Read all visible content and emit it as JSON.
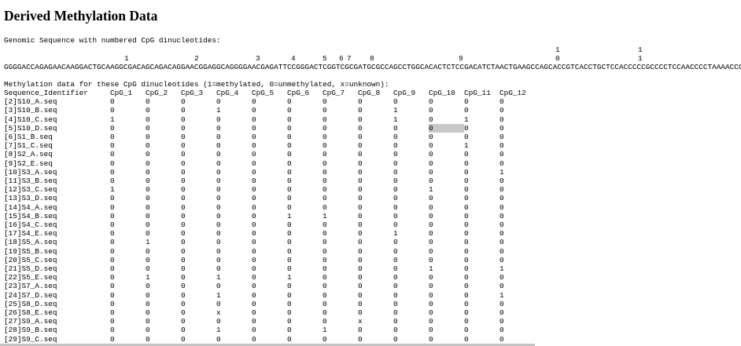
{
  "page": {
    "title": "Derived Methylation Data",
    "genomic_label": "Genomic Sequence with numbered CpG dinucleotides:",
    "sequence": "GGGGACCAGAGAACAAGGACTGCAAGGCGACAGCAGACAGGAACGGAGGCAGGGGAACGAGATTCCGGGACTCGGTCGCGATGCGCCAGCCTGGCACACTCTCCGACATCTAACTGAAGCCAGCACCGTCACCTGCTCCACCCCCGCCCCTCCAACCCCTAAAACCCC",
    "cpg_markers_top": [
      {
        "label": "1",
        "col": 706
      },
      {
        "label": "1",
        "col": 811
      }
    ],
    "cpg_markers": [
      {
        "label": "1",
        "col": 158
      },
      {
        "label": "2",
        "col": 247
      },
      {
        "label": "3",
        "col": 325
      },
      {
        "label": "4",
        "col": 370
      },
      {
        "label": "5",
        "col": 410
      },
      {
        "label": "6",
        "col": 431
      },
      {
        "label": "7",
        "col": 441
      },
      {
        "label": "8",
        "col": 470
      },
      {
        "label": "9",
        "col": 583
      },
      {
        "label": "0",
        "col": 706
      },
      {
        "label": "1",
        "col": 811
      }
    ],
    "methylation_label": "Methylation data for these CpG dinucleotides (1=methylated, 0=unmethylated, x=unknown):"
  },
  "table": {
    "headers": [
      "Sequence_Identifier",
      "CpG_1",
      "CpG_2",
      "CpG_3",
      "CpG_4",
      "CpG_5",
      "CpG_6",
      "CpG_7",
      "CpG_8",
      "CpG_9",
      "CpG_10",
      "CpG_11",
      "CpG_12"
    ],
    "rows": [
      [
        "[2]S10_A.seq",
        "0",
        "0",
        "0",
        "0",
        "0",
        "0",
        "0",
        "0",
        "0",
        "0",
        "0",
        "0"
      ],
      [
        "[3]S10_B.seq",
        "0",
        "0",
        "0",
        "1",
        "0",
        "0",
        "0",
        "0",
        "1",
        "0",
        "0",
        "0"
      ],
      [
        "[4]S10_C.seq",
        "1",
        "0",
        "0",
        "0",
        "0",
        "0",
        "0",
        "0",
        "1",
        "0",
        "1",
        "0"
      ],
      [
        "[5]S10_D.seq",
        "0",
        "0",
        "0",
        "0",
        "0",
        "0",
        "0",
        "0",
        "0",
        "0",
        "0",
        "0"
      ],
      [
        "[6]S1_B.seq",
        "0",
        "0",
        "0",
        "0",
        "0",
        "0",
        "0",
        "0",
        "0",
        "0",
        "0",
        "0"
      ],
      [
        "[7]S1_C.seq",
        "0",
        "0",
        "0",
        "0",
        "0",
        "0",
        "0",
        "0",
        "0",
        "0",
        "1",
        "0"
      ],
      [
        "[8]S2_A.seq",
        "0",
        "0",
        "0",
        "0",
        "0",
        "0",
        "0",
        "0",
        "0",
        "0",
        "0",
        "0"
      ],
      [
        "[9]S2_E.seq",
        "0",
        "0",
        "0",
        "0",
        "0",
        "0",
        "0",
        "0",
        "0",
        "0",
        "0",
        "0"
      ],
      [
        "[10]S3_A.seq",
        "0",
        "0",
        "0",
        "0",
        "0",
        "0",
        "0",
        "0",
        "0",
        "0",
        "0",
        "1"
      ],
      [
        "[11]S3_B.seq",
        "0",
        "0",
        "0",
        "0",
        "0",
        "0",
        "0",
        "0",
        "0",
        "0",
        "0",
        "0"
      ],
      [
        "[12]S3_C.seq",
        "1",
        "0",
        "0",
        "0",
        "0",
        "0",
        "0",
        "0",
        "0",
        "1",
        "0",
        "0"
      ],
      [
        "[13]S3_D.seq",
        "0",
        "0",
        "0",
        "0",
        "0",
        "0",
        "0",
        "0",
        "0",
        "0",
        "0",
        "0"
      ],
      [
        "[14]S4_A.seq",
        "0",
        "0",
        "0",
        "0",
        "0",
        "0",
        "0",
        "0",
        "0",
        "0",
        "0",
        "0"
      ],
      [
        "[15]S4_B.seq",
        "0",
        "0",
        "0",
        "0",
        "0",
        "1",
        "1",
        "0",
        "0",
        "0",
        "0",
        "0"
      ],
      [
        "[16]S4_C.seq",
        "0",
        "0",
        "0",
        "0",
        "0",
        "0",
        "0",
        "0",
        "0",
        "0",
        "0",
        "0"
      ],
      [
        "[17]S4_E.seq",
        "0",
        "0",
        "0",
        "0",
        "0",
        "0",
        "0",
        "0",
        "1",
        "0",
        "0",
        "0"
      ],
      [
        "[18]S5_A.seq",
        "0",
        "1",
        "0",
        "0",
        "0",
        "0",
        "0",
        "0",
        "0",
        "0",
        "0",
        "0"
      ],
      [
        "[19]S5_B.seq",
        "0",
        "0",
        "0",
        "0",
        "0",
        "0",
        "0",
        "0",
        "0",
        "0",
        "0",
        "0"
      ],
      [
        "[20]S5_C.seq",
        "0",
        "0",
        "0",
        "0",
        "0",
        "0",
        "0",
        "0",
        "0",
        "0",
        "0",
        "0"
      ],
      [
        "[21]S5_D.seq",
        "0",
        "0",
        "0",
        "0",
        "0",
        "0",
        "0",
        "0",
        "0",
        "1",
        "0",
        "1"
      ],
      [
        "[22]S5_E.seq",
        "0",
        "1",
        "0",
        "1",
        "0",
        "1",
        "0",
        "0",
        "0",
        "0",
        "0",
        "0"
      ],
      [
        "[23]S7_A.seq",
        "0",
        "0",
        "0",
        "0",
        "0",
        "0",
        "0",
        "0",
        "0",
        "0",
        "0",
        "0"
      ],
      [
        "[24]S7_D.seq",
        "0",
        "0",
        "0",
        "1",
        "0",
        "0",
        "0",
        "0",
        "0",
        "0",
        "0",
        "1"
      ],
      [
        "[25]S8_D.seq",
        "0",
        "0",
        "0",
        "0",
        "0",
        "0",
        "0",
        "0",
        "0",
        "0",
        "0",
        "0"
      ],
      [
        "[26]S8_E.seq",
        "0",
        "0",
        "0",
        "x",
        "0",
        "0",
        "0",
        "0",
        "0",
        "0",
        "0",
        "0"
      ],
      [
        "[27]S9_A.seq",
        "0",
        "0",
        "0",
        "0",
        "0",
        "0",
        "0",
        "x",
        "0",
        "0",
        "0",
        "0"
      ],
      [
        "[28]S9_B.seq",
        "0",
        "0",
        "0",
        "1",
        "0",
        "0",
        "1",
        "0",
        "0",
        "0",
        "0",
        "0"
      ],
      [
        "[29]S9_C.seq",
        "0",
        "0",
        "0",
        "0",
        "0",
        "0",
        "0",
        "0",
        "0",
        "0",
        "0",
        "0"
      ]
    ],
    "highlight": {
      "row": 3,
      "col": 10
    }
  }
}
